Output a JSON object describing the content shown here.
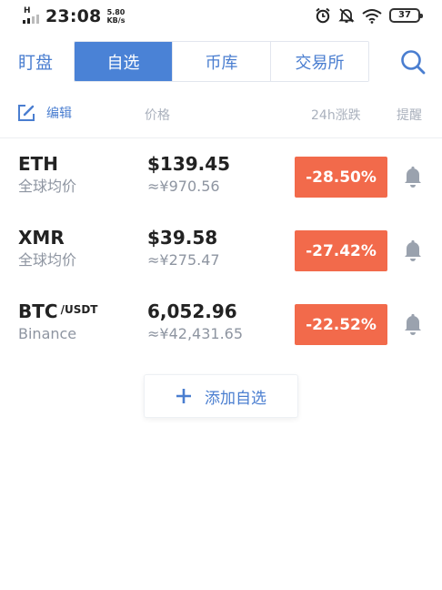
{
  "status_bar": {
    "network_type": "H",
    "time": "23:08",
    "speed_value": "5.80",
    "speed_unit": "KB/s",
    "battery": "37",
    "icons": [
      "alarm-icon",
      "mute-bell-icon",
      "wifi-icon",
      "battery-icon"
    ]
  },
  "nav": {
    "title": "盯盘",
    "tabs": [
      {
        "label": "自选",
        "active": true
      },
      {
        "label": "币库",
        "active": false
      },
      {
        "label": "交易所",
        "active": false
      }
    ],
    "search_icon": "search-icon"
  },
  "list_header": {
    "edit_label": "编辑",
    "price_col": "价格",
    "change_col": "24h涨跌",
    "alert_col": "提醒"
  },
  "rows": [
    {
      "coin": "ETH",
      "pair": "",
      "source": "全球均价",
      "price": "$139.45",
      "price_cny": "≈¥970.56",
      "change": "-28.50%"
    },
    {
      "coin": "XMR",
      "pair": "",
      "source": "全球均价",
      "price": "$39.58",
      "price_cny": "≈¥275.47",
      "change": "-27.42%"
    },
    {
      "coin": "BTC",
      "pair": "/USDT",
      "source": "Binance",
      "price": "6,052.96",
      "price_cny": "≈¥42,431.65",
      "change": "-22.52%"
    }
  ],
  "add_button": {
    "label": "添加自选"
  },
  "colors": {
    "accent": "#4a82d6",
    "text_link": "#4a7ed0",
    "negative": "#f26a4b",
    "muted": "#8e95a1",
    "header_muted": "#aab1bd",
    "bell": "#9aa2ae"
  }
}
